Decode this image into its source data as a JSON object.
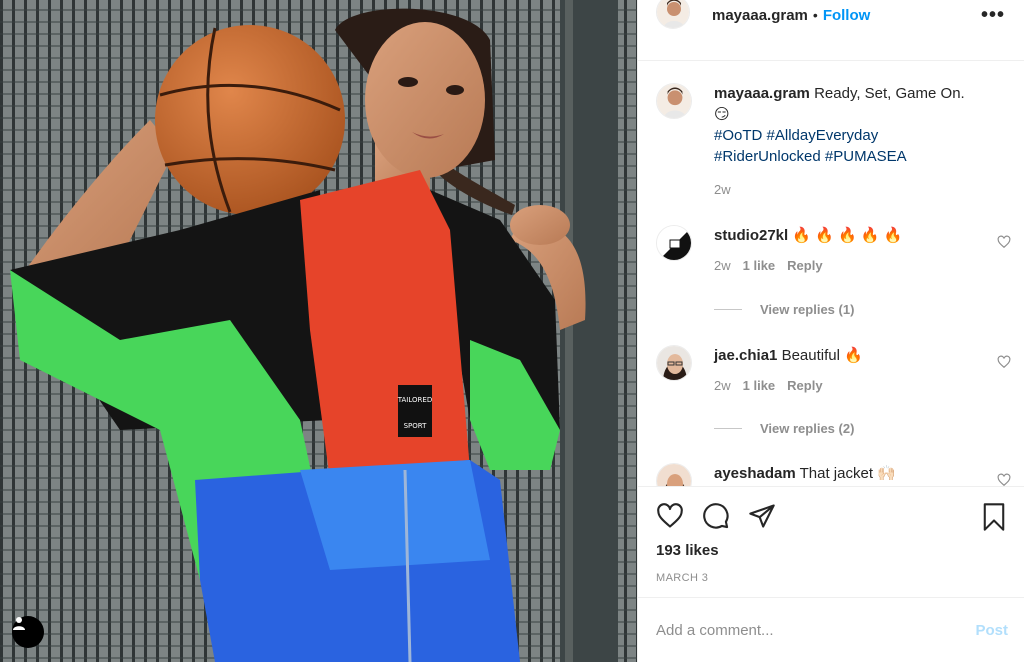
{
  "header": {
    "username": "mayaaa.gram",
    "separator": "•",
    "follow_label": "Follow",
    "more_icon": "more-horizontal-icon"
  },
  "caption": {
    "username": "mayaaa.gram",
    "text": "Ready, Set, Game On.",
    "emoji": "😏",
    "hashtags_line1": "#OoTD #AlldayEveryday",
    "hashtags_line2": "#RiderUnlocked #PUMASEA",
    "time": "2w"
  },
  "comments": [
    {
      "username": "studio27kl",
      "text": "🔥 🔥 🔥 🔥 🔥",
      "time": "2w",
      "likes": "1 like",
      "reply": "Reply",
      "view_replies": "View replies (1)"
    },
    {
      "username": "jae.chia1",
      "text": "Beautiful 🔥",
      "time": "2w",
      "likes": "1 like",
      "reply": "Reply",
      "view_replies": "View replies (2)"
    },
    {
      "username": "ayeshadam",
      "text": "That jacket 🙌🏻"
    }
  ],
  "actions": {
    "like_icon": "heart-icon",
    "comment_icon": "comment-icon",
    "share_icon": "paper-plane-icon",
    "save_icon": "bookmark-icon"
  },
  "likes": "193 likes",
  "date": "MARCH 3",
  "add_comment": {
    "placeholder": "Add a comment...",
    "post_label": "Post"
  },
  "colors": {
    "link_blue": "#0095f6",
    "hashtag": "#00376b",
    "muted": "#8e8e8e",
    "post_disabled": "#b2dffc"
  }
}
